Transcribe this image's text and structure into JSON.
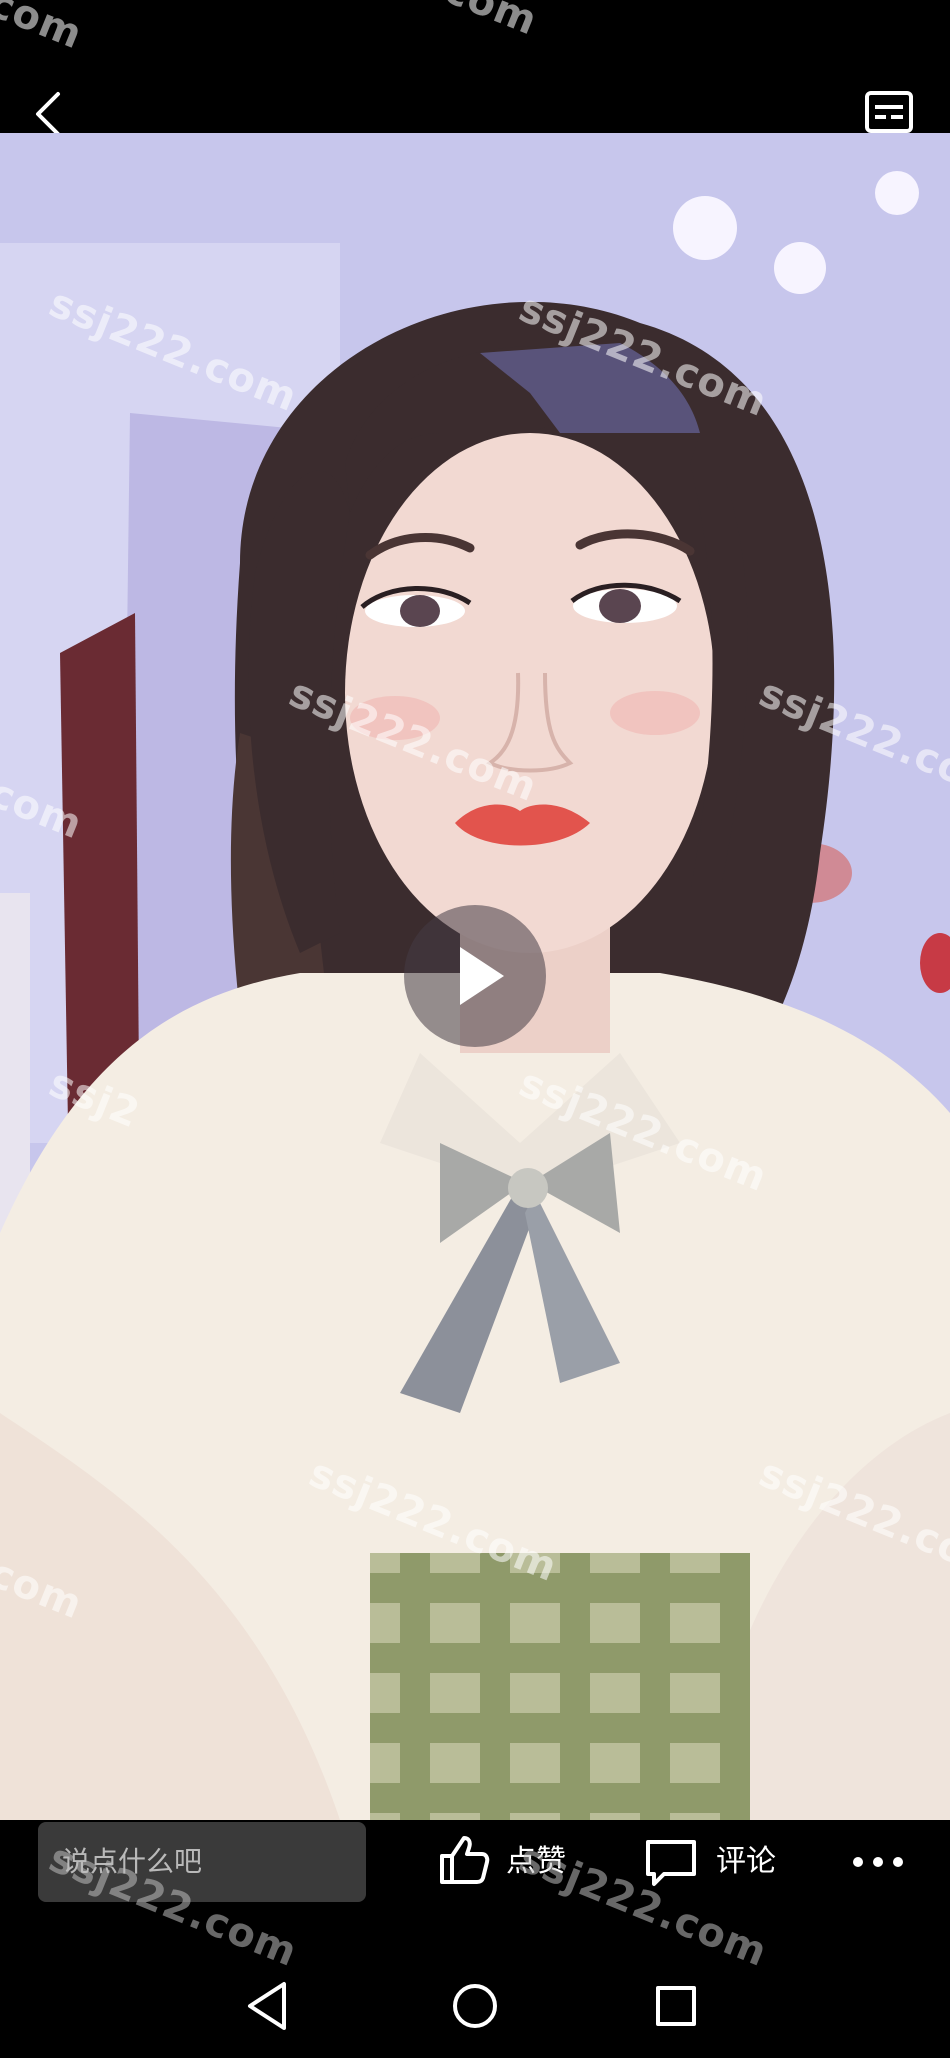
{
  "topbar": {
    "back_icon": "chevron-left-icon",
    "subtitle_icon": "subtitles-icon"
  },
  "video": {
    "play_icon": "play-icon",
    "colors": {
      "background_top": "#bfc0e8",
      "background_bottom": "#e2d9d5",
      "hair": "#3b2c2e",
      "skin": "#f0d7d0",
      "shirt": "#f4ede3",
      "skirt_check": "#9aa57a"
    }
  },
  "watermarks": [
    "ssj222.com",
    "ssj222.com",
    "ssj222.com",
    "ssj222.com",
    "ssj222.com",
    "ssj222.com",
    "ssj222.com",
    "ssj222.com",
    "ssj222.com",
    "ssj222.com",
    ".com",
    ".com",
    "com",
    "com",
    "com",
    "ssj2"
  ],
  "actionbar": {
    "comment_placeholder": "说点什么吧",
    "like_label": "点赞",
    "comment_label": "评论",
    "like_icon": "thumbs-up-icon",
    "comment_icon": "speech-bubble-icon",
    "more_icon": "more-horizontal-icon"
  },
  "navbar": {
    "back_icon": "triangle-back-icon",
    "home_icon": "circle-home-icon",
    "recent_icon": "square-recents-icon"
  }
}
